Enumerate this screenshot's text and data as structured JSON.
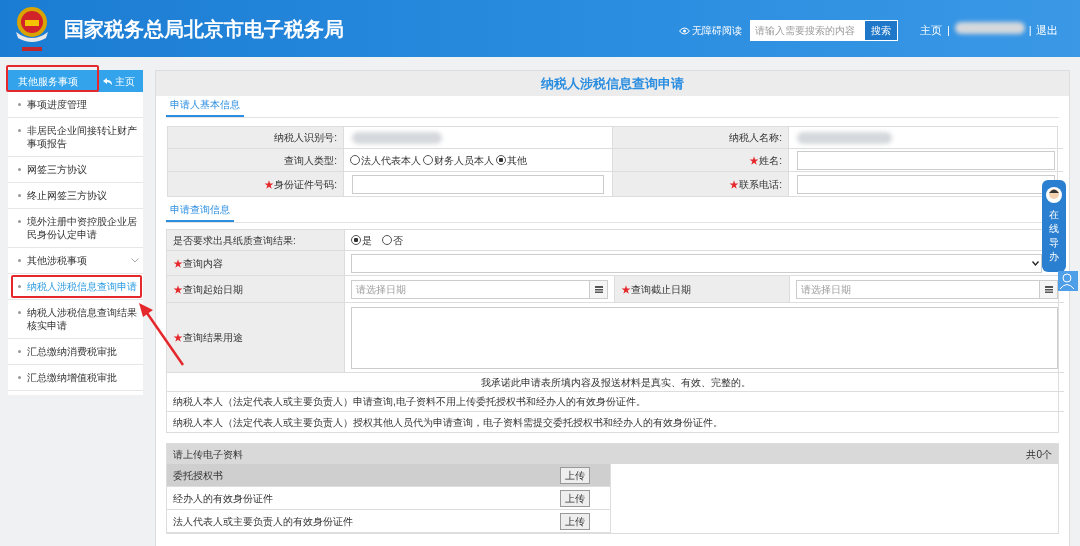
{
  "header": {
    "title": "国家税务总局北京市电子税务局",
    "accessibility": "无障碍阅读",
    "search": {
      "placeholder": "请输入需要搜索的内容"
    },
    "search_button": "搜索",
    "nav": [
      "主页",
      "退出"
    ],
    "separators": [
      "|",
      "|"
    ]
  },
  "required_mark": "★",
  "sidebar": {
    "title": "其他服务事项",
    "home_button": "主页",
    "items": [
      {
        "label": "事项进度管理",
        "selected": false,
        "kind": "link"
      },
      {
        "label": "非居民企业间接转让财产事项报告",
        "selected": false,
        "kind": "link"
      },
      {
        "label": "网签三方协议",
        "selected": false,
        "kind": "link"
      },
      {
        "label": "终止网签三方协议",
        "selected": false,
        "kind": "link"
      },
      {
        "label": "境外注册中资控股企业居民身份认定申请",
        "selected": false,
        "kind": "link"
      },
      {
        "label": "其他涉税事项",
        "selected": false,
        "kind": "group"
      },
      {
        "label": "纳税人涉税信息查询申请",
        "selected": true,
        "kind": "link"
      },
      {
        "label": "纳税人涉税信息查询结果核实申请",
        "selected": false,
        "kind": "link"
      },
      {
        "label": "汇总缴纳消费税审批",
        "selected": false,
        "kind": "link"
      },
      {
        "label": "汇总缴纳增值税审批",
        "selected": false,
        "kind": "link"
      }
    ]
  },
  "page_title": "纳税人涉税信息查询申请",
  "basic_info": {
    "tab": "申请人基本信息",
    "taxpayer_id_label": {
      "text": "纳税人识别号:",
      "required": false
    },
    "taxpayer_name_label": {
      "text": "纳税人名称:",
      "required": false
    },
    "requester_type_label": {
      "text": "查询人类型:",
      "required": false
    },
    "requester_types": [
      {
        "label": "法人代表本人",
        "selected": false
      },
      {
        "label": "财务人员本人",
        "selected": false
      },
      {
        "label": "其他",
        "selected": true
      }
    ],
    "name_label": {
      "text": "姓名:",
      "required": true
    },
    "id_number_label": {
      "text": "身份证件号码:",
      "required": true
    },
    "phone_label": {
      "text": "联系电话:",
      "required": true
    }
  },
  "query_info": {
    "tab": "申请查询信息",
    "paper_label": {
      "text": "是否要求出具纸质查询结果:",
      "required": false
    },
    "paper_options": [
      {
        "label": "是",
        "selected": true
      },
      {
        "label": "否",
        "selected": false
      }
    ],
    "content_label": {
      "text": "查询内容",
      "required": true
    },
    "start_label": {
      "text": "查询起始日期",
      "required": true
    },
    "start": {
      "placeholder": "请选择日期"
    },
    "end_label": {
      "text": "查询截止日期",
      "required": true
    },
    "end": {
      "placeholder": "请选择日期"
    },
    "purpose_label": {
      "text": "查询结果用途",
      "required": true
    },
    "pledge": "我承诺此申请表所填内容及报送材料是真实、有效、完整的。",
    "notes": [
      "纳税人本人（法定代表人或主要负责人）申请查询,电子资料不用上传委托授权书和经办人的有效身份证件。",
      "纳税人本人（法定代表人或主要负责人）授权其他人员代为申请查询，电子资料需提交委托授权书和经办人的有效身份证件。"
    ]
  },
  "upload": {
    "title": "请上传电子资料",
    "count": "共0个",
    "items": [
      {
        "label": "委托授权书",
        "button": "上传",
        "selected": true
      },
      {
        "label": "经办人的有效身份证件",
        "button": "上传",
        "selected": false
      },
      {
        "label": "法人代表人或主要负责人的有效身份证件",
        "button": "上传",
        "selected": false
      }
    ]
  },
  "online_guide": "在线导办"
}
